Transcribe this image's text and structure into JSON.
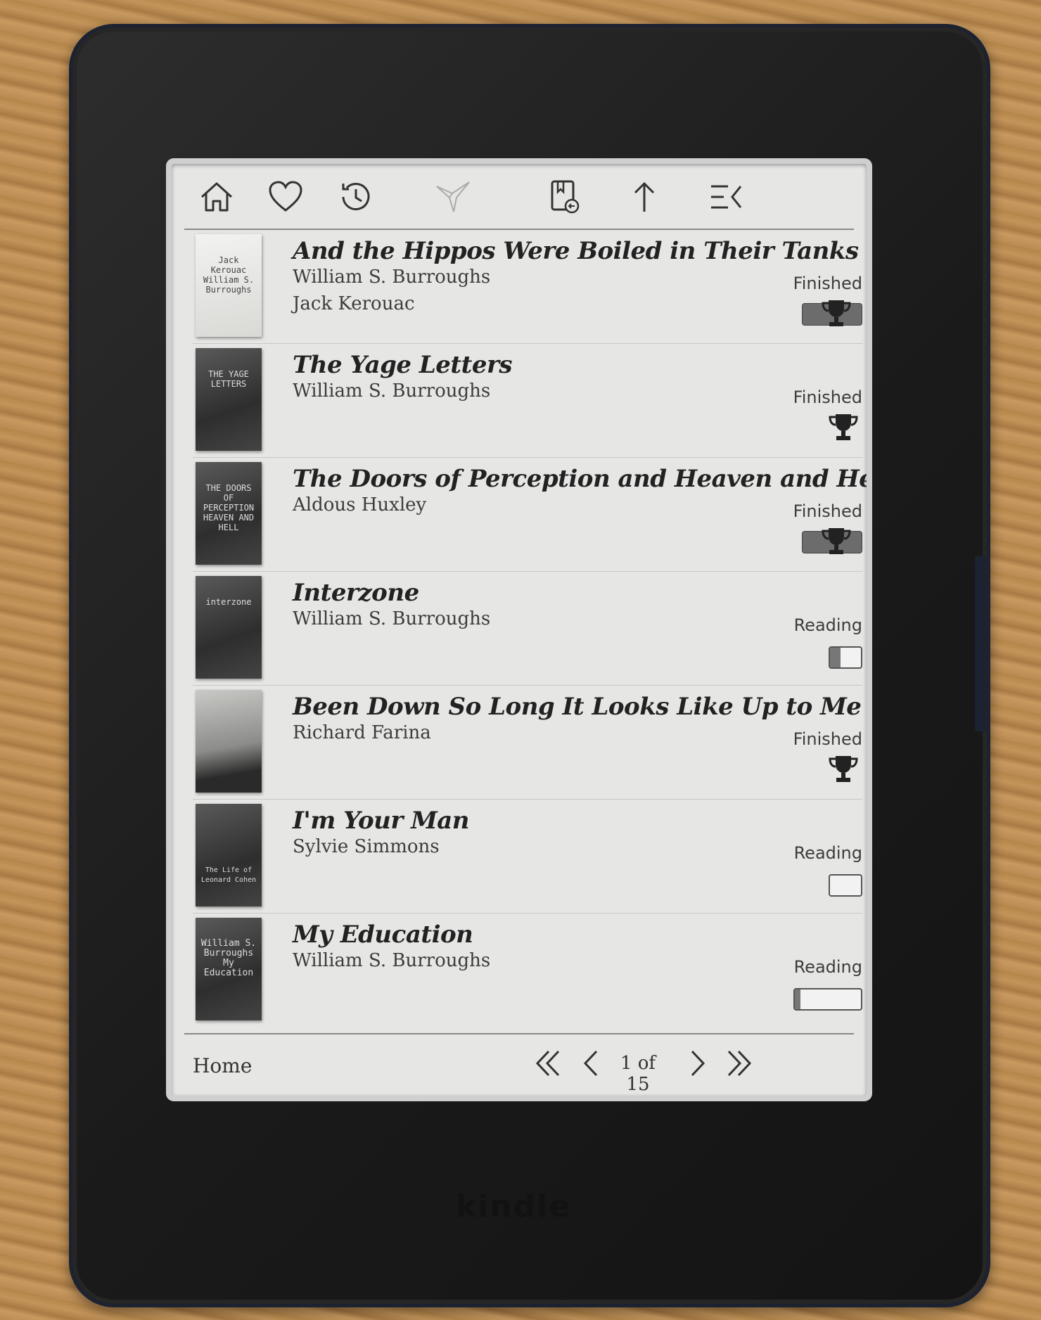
{
  "device": {
    "brand": "kindle"
  },
  "toolbar": {
    "icons": [
      "home-icon",
      "heart-icon",
      "history-icon",
      "bird-icon",
      "bookmark-icon",
      "upload-icon",
      "menu-icon"
    ]
  },
  "books": [
    {
      "title": "And the Hippos Were Boiled in Their Tanks",
      "authors": [
        "William S. Burroughs",
        "Jack Kerouac"
      ],
      "status": "Finished",
      "progress": 1.0,
      "cover_text": "Jack Kerouac William S. Burroughs"
    },
    {
      "title": "The Yage Letters",
      "authors": [
        "William S. Burroughs"
      ],
      "status": "Finished",
      "progress": 1.0,
      "cover_text": "THE YAGE LETTERS"
    },
    {
      "title": "The Doors of Perception and Heaven and Hell",
      "authors": [
        "Aldous Huxley"
      ],
      "status": "Finished",
      "progress": 1.0,
      "cover_text": "THE DOORS OF PERCEPTION HEAVEN AND HELL"
    },
    {
      "title": "Interzone",
      "authors": [
        "William S. Burroughs"
      ],
      "status": "Reading",
      "progress": 0.35,
      "cover_text": "interzone"
    },
    {
      "title": "Been Down So Long It Looks Like Up to Me",
      "authors": [
        "Richard Farina"
      ],
      "status": "Finished",
      "progress": 1.0,
      "cover_text": ""
    },
    {
      "title": "I'm Your Man",
      "authors": [
        "Sylvie Simmons"
      ],
      "status": "Reading",
      "progress": 0.0,
      "cover_text": "The Life of Leonard Cohen"
    },
    {
      "title": "My Education",
      "authors": [
        "William S. Burroughs"
      ],
      "status": "Reading",
      "progress": 0.08,
      "cover_text": "William S. Burroughs My Education"
    }
  ],
  "footer": {
    "home_label": "Home",
    "page_label": "1 of 15"
  }
}
